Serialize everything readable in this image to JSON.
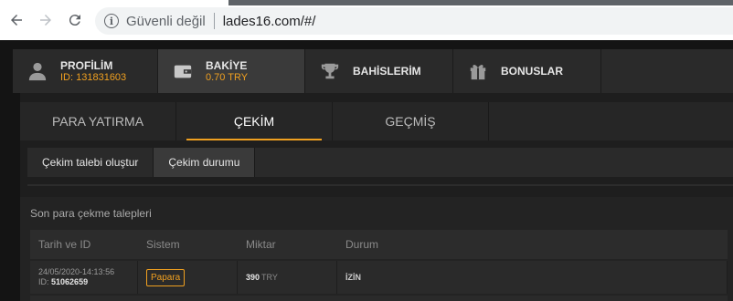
{
  "browser": {
    "security_text": "Güvenli değil",
    "url": "lades16.com/#/"
  },
  "top_tabs": [
    {
      "title": "PROFİLİM",
      "subtitle": "ID: 131831603",
      "icon": "user-icon"
    },
    {
      "title": "BAKİYE",
      "subtitle": "0.70 TRY",
      "icon": "wallet-icon"
    },
    {
      "title": "BAHİSLERİM",
      "icon": "trophy-icon"
    },
    {
      "title": "BONUSLAR",
      "icon": "gift-icon"
    }
  ],
  "sub_tabs": [
    "PARA YATIRMA",
    "ÇEKİM",
    "GEÇMİŞ"
  ],
  "actions": [
    "Çekim talebi oluştur",
    "Çekim durumu"
  ],
  "requests": {
    "title": "Son para çekme talepleri",
    "headers": [
      "Tarih ve ID",
      "Sistem",
      "Miktar",
      "Durum"
    ],
    "rows": [
      {
        "date": "24/05/2020-14:13:56",
        "id_label": "ID:",
        "id": "51062659",
        "system": "Papara",
        "amount": "390",
        "currency": "TRY",
        "status": "İZİN"
      }
    ]
  },
  "colors": {
    "accent": "#f0a020"
  }
}
